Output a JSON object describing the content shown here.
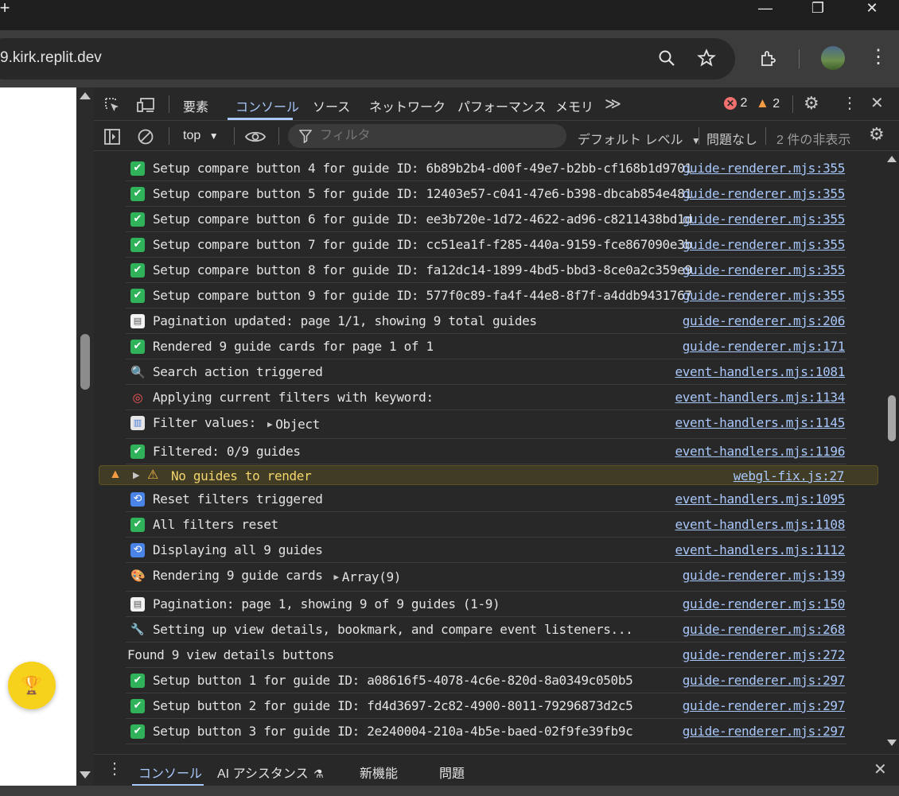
{
  "window": {
    "new_tab": "+",
    "minimize": "—",
    "restore": "❐",
    "close": "✕"
  },
  "toolbar": {
    "url": "9.kirk.replit.dev"
  },
  "devtools": {
    "tabs": [
      {
        "label": "要素"
      },
      {
        "label": "コンソール"
      },
      {
        "label": "ソース"
      },
      {
        "label": "ネットワーク"
      },
      {
        "label": "パフォーマンス"
      },
      {
        "label": "メモリ"
      }
    ],
    "more_tabs": "≫",
    "error_count": "2",
    "warning_count": "2",
    "filter": {
      "context": "top",
      "placeholder": "フィルタ",
      "level": "デフォルト レベル",
      "issues": "問題なし",
      "hidden": "2 件の非表示"
    },
    "drawer": {
      "tabs": [
        {
          "label": "コンソール"
        },
        {
          "label": "AI アシスタンス"
        },
        {
          "label": "新機能"
        },
        {
          "label": "問題"
        }
      ]
    }
  },
  "console": {
    "rows": [
      {
        "icon": "✔",
        "text": "Setup compare button 4 for guide ID: 6b89b2b4-d00f-49e7-b2bb-cf168b1d9701",
        "source": "guide-renderer.mjs:355"
      },
      {
        "icon": "✔",
        "text": "Setup compare button 5 for guide ID: 12403e57-c041-47e6-b398-dbcab854e481",
        "source": "guide-renderer.mjs:355"
      },
      {
        "icon": "✔",
        "text": "Setup compare button 6 for guide ID: ee3b720e-1d72-4622-ad96-c8211438bd1d",
        "source": "guide-renderer.mjs:355"
      },
      {
        "icon": "✔",
        "text": "Setup compare button 7 for guide ID: cc51ea1f-f285-440a-9159-fce867090e3b",
        "source": "guide-renderer.mjs:355"
      },
      {
        "icon": "✔",
        "text": "Setup compare button 8 for guide ID: fa12dc14-1899-4bd5-bbd3-8ce0a2c359e9",
        "source": "guide-renderer.mjs:355"
      },
      {
        "icon": "✔",
        "text": "Setup compare button 9 for guide ID: 577f0c89-fa4f-44e8-8f7f-a4ddb9431767",
        "source": "guide-renderer.mjs:355"
      },
      {
        "icon": "▤",
        "text": "Pagination updated: page 1/1, showing 9 total guides",
        "source": "guide-renderer.mjs:206"
      },
      {
        "icon": "✔",
        "text": "Rendered 9 guide cards for page 1 of 1",
        "source": "guide-renderer.mjs:171"
      },
      {
        "icon": "🔍",
        "text": "Search action triggered",
        "source": "event-handlers.mjs:1081"
      },
      {
        "icon": "◎",
        "text": "Applying current filters with keyword:",
        "source": "event-handlers.mjs:1134"
      },
      {
        "icon": "▥",
        "text": "Filter values:",
        "expand": "Object",
        "source": "event-handlers.mjs:1145"
      },
      {
        "icon": "✔",
        "text": "Filtered: 0/9 guides",
        "source": "event-handlers.mjs:1196"
      },
      {
        "icon": "⚠",
        "text": "No guides to render",
        "source": "webgl-fix.js:27"
      },
      {
        "icon": "⟲",
        "text": "Reset filters triggered",
        "source": "event-handlers.mjs:1095"
      },
      {
        "icon": "✔",
        "text": "All filters reset",
        "source": "event-handlers.mjs:1108"
      },
      {
        "icon": "⟲",
        "text": "Displaying all 9 guides",
        "source": "event-handlers.mjs:1112"
      },
      {
        "icon": "🎨",
        "text": "Rendering 9 guide cards",
        "expand": "Array(9)",
        "source": "guide-renderer.mjs:139"
      },
      {
        "icon": "▤",
        "text": "Pagination: page 1, showing 9 of 9 guides (1-9)",
        "source": "guide-renderer.mjs:150"
      },
      {
        "icon": "🔧",
        "text": "Setting up view details, bookmark, and compare event listeners...",
        "source": "guide-renderer.mjs:268"
      },
      {
        "icon": "",
        "text": "Found 9 view details buttons",
        "source": "guide-renderer.mjs:272"
      },
      {
        "icon": "✔",
        "text": "Setup button 1 for guide ID: a08616f5-4078-4c6e-820d-8a0349c050b5",
        "source": "guide-renderer.mjs:297"
      },
      {
        "icon": "✔",
        "text": "Setup button 2 for guide ID: fd4d3697-2c82-4900-8011-79296873d2c5",
        "source": "guide-renderer.mjs:297"
      },
      {
        "icon": "✔",
        "text": "Setup button 3 for guide ID: 2e240004-210a-4b5e-baed-02f9fe39fb9c",
        "source": "guide-renderer.mjs:297"
      }
    ]
  }
}
